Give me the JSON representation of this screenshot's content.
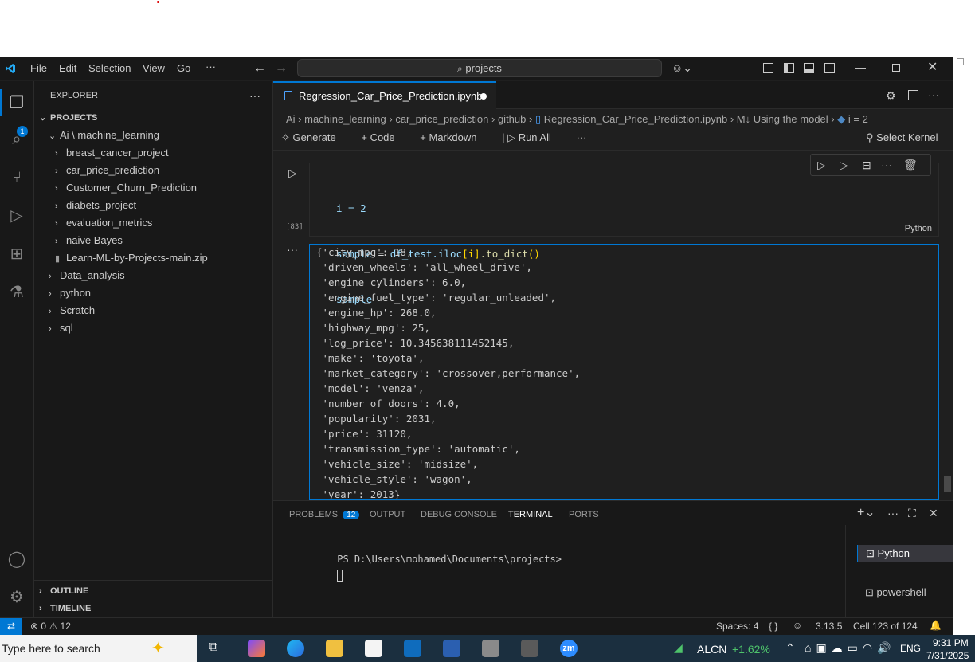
{
  "menu": {
    "items": [
      "File",
      "Edit",
      "Selection",
      "View",
      "Go"
    ],
    "more": "···"
  },
  "search": {
    "text": "projects"
  },
  "explorer": {
    "title": "EXPLORER",
    "section": "PROJECTS",
    "tree": [
      {
        "label": "Ai \\ machine_learning",
        "depth": 1,
        "chev": "⌄"
      },
      {
        "label": "breast_cancer_project",
        "depth": 2,
        "chev": "›"
      },
      {
        "label": "car_price_prediction",
        "depth": 2,
        "chev": "›"
      },
      {
        "label": "Customer_Churn_Prediction",
        "depth": 2,
        "chev": "›"
      },
      {
        "label": "diabets_project",
        "depth": 2,
        "chev": "›"
      },
      {
        "label": "evaluation_metrics",
        "depth": 2,
        "chev": "›"
      },
      {
        "label": "naive Bayes",
        "depth": 2,
        "chev": "›"
      },
      {
        "label": "Learn-ML-by-Projects-main.zip",
        "depth": 2,
        "chev": ""
      },
      {
        "label": "Data_analysis",
        "depth": 1,
        "chev": "›"
      },
      {
        "label": "python",
        "depth": 1,
        "chev": "›"
      },
      {
        "label": "Scratch",
        "depth": 1,
        "chev": "›"
      },
      {
        "label": "sql",
        "depth": 1,
        "chev": "›"
      }
    ],
    "outline": "OUTLINE",
    "timeline": "TIMELINE"
  },
  "activity": {
    "explorer_badge": "1"
  },
  "editor": {
    "tab_label": "Regression_Car_Price_Prediction.ipynb",
    "breadcrumb": [
      "Ai",
      "machine_learning",
      "car_price_prediction",
      "github",
      "Regression_Car_Price_Prediction.ipynb",
      "M↓ Using the model",
      "i = 2"
    ],
    "toolbar": {
      "generate": "Generate",
      "code": "Code",
      "markdown": "Markdown",
      "run_all": "Run All",
      "more": "···",
      "select_kernel": "Select Kernel"
    },
    "cell": {
      "exec_count": "[83]",
      "language": "Python",
      "code_line1": "i = 2",
      "code_line2_var": "sample",
      "code_line2_eq": " = ",
      "code_line2_obj": "df_test",
      "code_line2_iloc": ".iloc",
      "code_line2_idx": "[i]",
      "code_line2_fn": ".to_dict",
      "code_line2_paren": "()",
      "code_line3": "sample"
    },
    "output": [
      "{'city_mpg': 18,",
      " 'driven_wheels': 'all_wheel_drive',",
      " 'engine_cylinders': 6.0,",
      " 'engine_fuel_type': 'regular_unleaded',",
      " 'engine_hp': 268.0,",
      " 'highway_mpg': 25,",
      " 'log_price': 10.345638111452145,",
      " 'make': 'toyota',",
      " 'market_category': 'crossover,performance',",
      " 'model': 'venza',",
      " 'number_of_doors': 4.0,",
      " 'popularity': 2031,",
      " 'price': 31120,",
      " 'transmission_type': 'automatic',",
      " 'vehicle_size': 'midsize',",
      " 'vehicle_style': 'wagon',",
      " 'year': 2013}"
    ]
  },
  "panel": {
    "tabs": {
      "problems": "PROBLEMS",
      "problems_count": "12",
      "output": "OUTPUT",
      "debug": "DEBUG CONSOLE",
      "terminal": "TERMINAL",
      "ports": "PORTS"
    },
    "prompt": "PS D:\\Users\\mohamed\\Documents\\projects>",
    "terminals": [
      "powershell",
      "Python"
    ]
  },
  "status": {
    "errors": "0",
    "warnings": "12",
    "spaces": "Spaces: 4",
    "braces": "{ }",
    "version": "3.13.5",
    "cell": "Cell 123 of 124"
  },
  "taskbar": {
    "search_placeholder": "Type here to search",
    "stock": "ALCN",
    "stock_change": "+1.62%",
    "lang": "ENG",
    "time": "9:31 PM",
    "date": "7/31/2025",
    "zoom_label": "zm"
  },
  "colors": {
    "accent": "#0078d4",
    "keyword": "#9cdcfe",
    "func": "#dcdcaa",
    "string": "#ce9178",
    "stock_up": "#4ec36b"
  }
}
